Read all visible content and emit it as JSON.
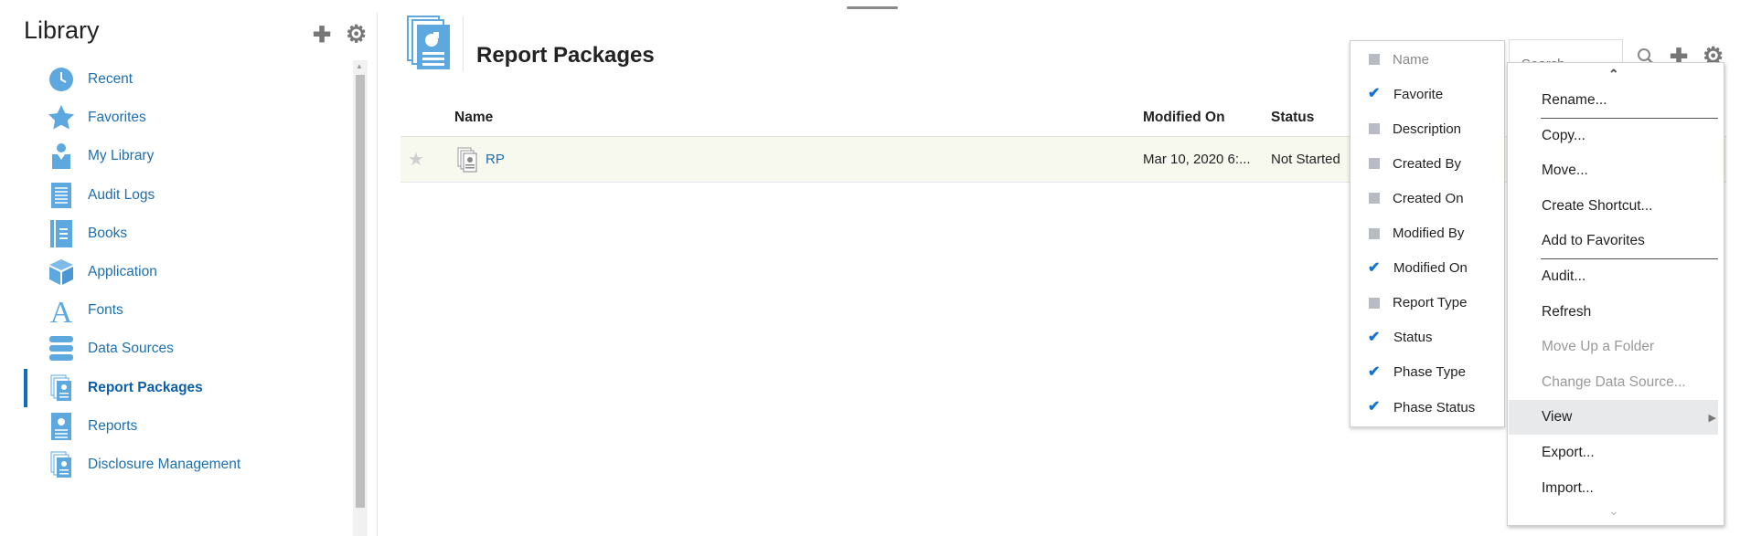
{
  "sidebar": {
    "title": "Library",
    "add_icon": "plus-icon",
    "settings_icon": "gear-icon",
    "items": [
      {
        "label": "Recent",
        "icon": "clock-icon"
      },
      {
        "label": "Favorites",
        "icon": "star-icon"
      },
      {
        "label": "My Library",
        "icon": "user-icon"
      },
      {
        "label": "Audit Logs",
        "icon": "document-lines-icon"
      },
      {
        "label": "Books",
        "icon": "book-icon"
      },
      {
        "label": "Application",
        "icon": "cube-icon"
      },
      {
        "label": "Fonts",
        "icon": "font-icon"
      },
      {
        "label": "Data Sources",
        "icon": "database-icon"
      },
      {
        "label": "Report Packages",
        "icon": "report-package-icon",
        "active": true
      },
      {
        "label": "Reports",
        "icon": "report-icon"
      },
      {
        "label": "Disclosure Management",
        "icon": "report-package-icon"
      }
    ]
  },
  "main": {
    "title": "Report Packages",
    "search": {
      "placeholder": "Search"
    },
    "table": {
      "columns": [
        "Name",
        "Modified On",
        "Status"
      ],
      "rows": [
        {
          "name": "RP",
          "modified_on": "Mar 10, 2020 6:...",
          "status": "Not Started",
          "favorite": false
        }
      ]
    }
  },
  "column_menu": {
    "items": [
      {
        "label": "Name",
        "checked": false,
        "disabled": true
      },
      {
        "label": "Favorite",
        "checked": true
      },
      {
        "label": "Description",
        "checked": false
      },
      {
        "label": "Created By",
        "checked": false
      },
      {
        "label": "Created On",
        "checked": false
      },
      {
        "label": "Modified By",
        "checked": false
      },
      {
        "label": "Modified On",
        "checked": true
      },
      {
        "label": "Report Type",
        "checked": false
      },
      {
        "label": "Status",
        "checked": true
      },
      {
        "label": "Phase Type",
        "checked": true
      },
      {
        "label": "Phase Status",
        "checked": true
      }
    ]
  },
  "context_menu": {
    "items": [
      {
        "label": "Rename..."
      },
      {
        "label": "Copy..."
      },
      {
        "label": "Move..."
      },
      {
        "label": "Create Shortcut..."
      },
      {
        "label": "Add to Favorites"
      },
      {
        "label": "Audit..."
      },
      {
        "label": "Refresh"
      },
      {
        "label": "Move Up a Folder",
        "disabled": true
      },
      {
        "label": "Change Data Source...",
        "disabled": true
      },
      {
        "label": "View",
        "highlighted": true,
        "submenu": true
      },
      {
        "label": "Export..."
      },
      {
        "label": "Import..."
      }
    ]
  },
  "colors": {
    "accent": "#1c6fb0",
    "icon_blue": "#5ea8e0",
    "row_bg": "#f7f8ee",
    "check": "#1373d3"
  }
}
